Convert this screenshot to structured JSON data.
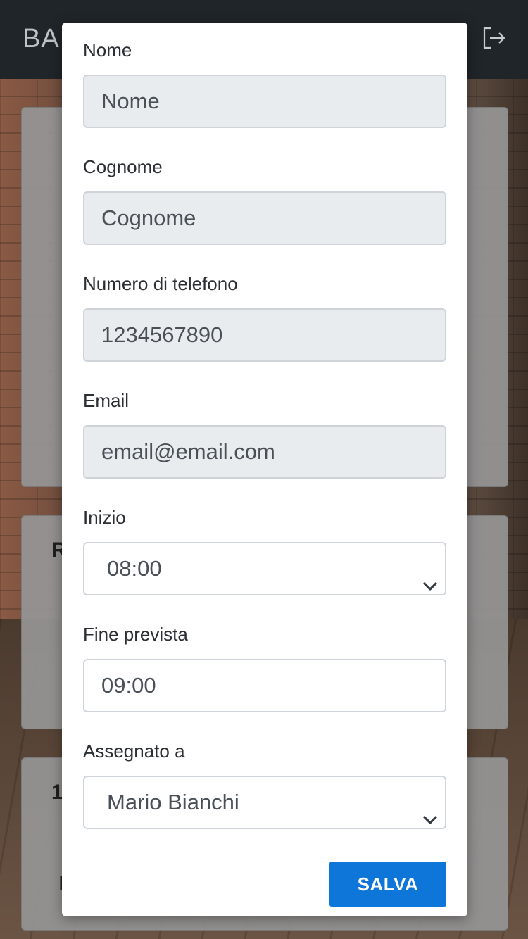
{
  "navbar": {
    "brand": "BAI",
    "logout_icon": "logout-icon"
  },
  "background_cards": {
    "card2_text": "R",
    "card3_text": "1",
    "card3_bottom_text": "M"
  },
  "form": {
    "nome": {
      "label": "Nome",
      "placeholder": "Nome"
    },
    "cognome": {
      "label": "Cognome",
      "placeholder": "Cognome"
    },
    "telefono": {
      "label": "Numero di telefono",
      "value": "1234567890"
    },
    "email": {
      "label": "Email",
      "value": "email@email.com"
    },
    "inizio": {
      "label": "Inizio",
      "value": "08:00"
    },
    "fine": {
      "label": "Fine prevista",
      "value": "09:00"
    },
    "assegnato": {
      "label": "Assegnato a",
      "value": "Mario Bianchi"
    },
    "save_label": "SALVA"
  },
  "colors": {
    "navbar": "#202529",
    "save_button": "#0d76d8",
    "readonly_field": "#e9ecef"
  }
}
